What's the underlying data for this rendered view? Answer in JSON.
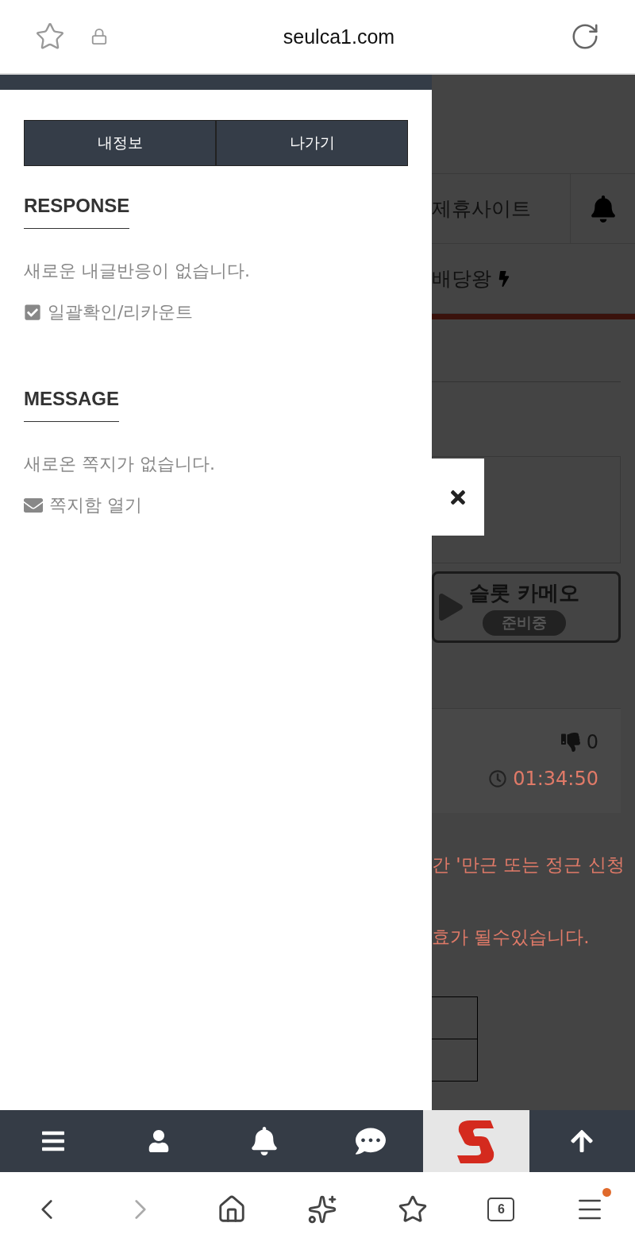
{
  "browser": {
    "url": "seulca1.com",
    "tab_count": "6"
  },
  "drawer": {
    "buttons": [
      "내정보",
      "나가기"
    ],
    "sections": [
      {
        "title": "RESPONSE",
        "text": "새로운 내글반응이 없습니다.",
        "action": {
          "kind": "check",
          "label": "일괄확인/리카운트"
        }
      },
      {
        "title": "MESSAGE",
        "text": "새로온 쪽지가 없습니다.",
        "action": {
          "kind": "mail",
          "label": "쪽지함 열기"
        }
      }
    ]
  },
  "page": {
    "nav_items": [
      "제휴사이트",
      "배당왕"
    ],
    "banner": {
      "title": "슬롯 카메오",
      "badge": "준비중"
    },
    "post": {
      "dislikes": "0",
      "time": "01:34:50"
    },
    "notices": [
      "간 '만근 또는 정근 신청",
      "효가 될수있습니다."
    ]
  }
}
